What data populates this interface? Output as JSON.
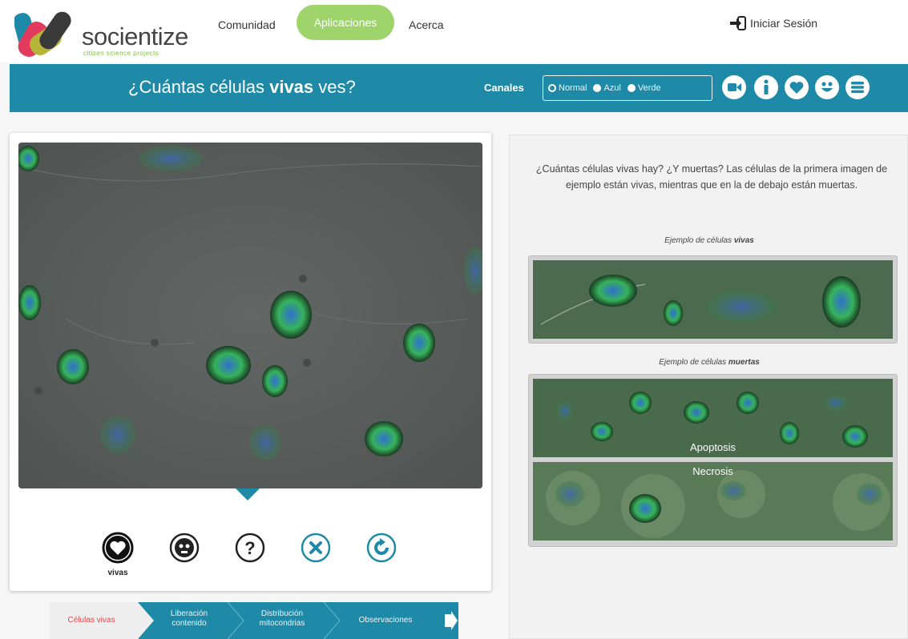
{
  "nav": {
    "brand": "socientize",
    "brand_sub": "citizen science projects",
    "items": [
      "Comunidad",
      "Aplicaciones",
      "Acerca"
    ],
    "active": "Aplicaciones",
    "login": "Iniciar Sesión"
  },
  "titlebar": {
    "title_pre": "¿Cuántas células ",
    "title_bold": "vivas",
    "title_post": " ves?",
    "canales_label": "Canales",
    "channels": [
      "Normal",
      "Azul",
      "Verde"
    ],
    "selected_channel": "Normal",
    "tool_icons": [
      "video-icon",
      "info-icon",
      "heart-icon",
      "smiley-icon",
      "menu-icon"
    ]
  },
  "answers": {
    "icons": [
      "heart-icon",
      "skull-icon",
      "question-icon",
      "close-icon",
      "refresh-icon"
    ],
    "selected_label": "vivas"
  },
  "steps": [
    "Células vivas",
    "Liberación contenido",
    "Distribución mitocondrias",
    "Observaciones"
  ],
  "help": {
    "intro": "¿Cuántas células vivas hay? ¿Y muertas? Las células de la primera imagen de ejemplo están vivas, mientras que en la de debajo están muertas.",
    "caption_live_pre": "Ejemplo de células ",
    "caption_live_bold": "vivas",
    "caption_dead_pre": "Ejemplo de células ",
    "caption_dead_bold": "muertas",
    "apoptosis": "Apoptosis",
    "necrosis": "Necrosis"
  },
  "colors": {
    "teal": "#1e8aa8",
    "green_active": "#9fd46c",
    "red_step": "#e04a4a"
  }
}
